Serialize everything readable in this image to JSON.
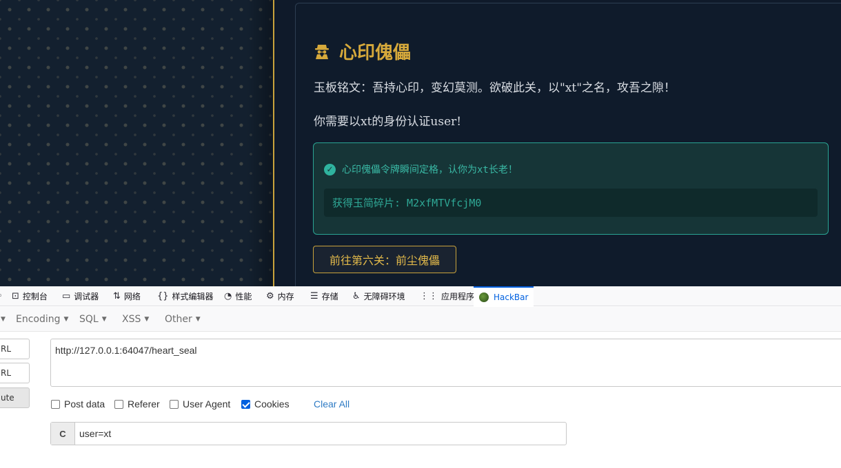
{
  "page": {
    "title": "心印傀儡",
    "paragraph1": "玉板铭文：吾持心印，变幻莫测。欲破此关，以\"xt\"之名，攻吾之隙！",
    "paragraph2": "你需要以xt的身份认证user!",
    "success_message": "心印傀儡令牌瞬间定格，认你为xt长老！",
    "fragment_text": "获得玉简碎片: M2xfMTVfcjM0",
    "next_button": "前往第六关：前尘傀儡",
    "colors": {
      "gold": "#d6a93b",
      "teal": "#39b8a4",
      "background": "#0f1b2b"
    }
  },
  "devtools": {
    "tabs": [
      {
        "label": "控制台",
        "icon": "console-icon"
      },
      {
        "label": "调试器",
        "icon": "debugger-icon"
      },
      {
        "label": "网络",
        "icon": "network-icon"
      },
      {
        "label": "样式编辑器",
        "icon": "style-editor-icon"
      },
      {
        "label": "性能",
        "icon": "performance-icon"
      },
      {
        "label": "内存",
        "icon": "memory-icon"
      },
      {
        "label": "存储",
        "icon": "storage-icon"
      },
      {
        "label": "无障碍环境",
        "icon": "accessibility-icon"
      },
      {
        "label": "应用程序",
        "icon": "application-icon"
      },
      {
        "label": "HackBar",
        "icon": "hackbar-icon"
      }
    ],
    "active_tab": "HackBar"
  },
  "hackbar": {
    "menu": [
      "Encoding",
      "SQL",
      "XSS",
      "Other"
    ],
    "side_buttons": [
      "RL",
      "RL",
      "ute"
    ],
    "url": "http://127.0.0.1:64047/heart_seal",
    "options": [
      {
        "label": "Post data",
        "checked": false
      },
      {
        "label": "Referer",
        "checked": false
      },
      {
        "label": "User Agent",
        "checked": false
      },
      {
        "label": "Cookies",
        "checked": true
      }
    ],
    "clear_all": "Clear All",
    "cookie_label": "C",
    "cookie_value": "user=xt"
  }
}
